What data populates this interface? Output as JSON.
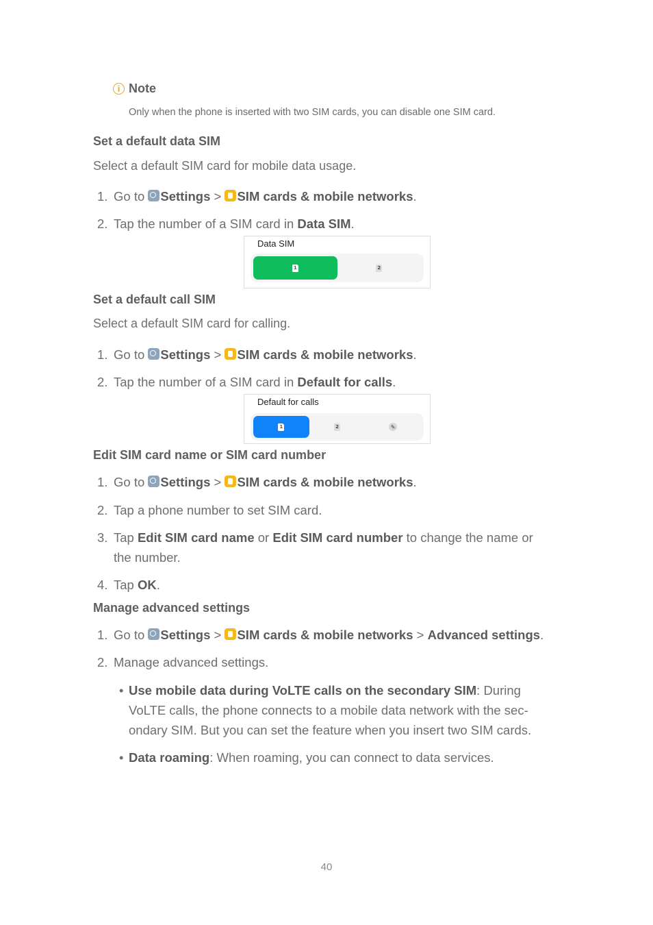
{
  "note": {
    "title": "Note",
    "icon": "info-icon",
    "text": "Only when the phone is inserted with two SIM cards, you can disable one SIM card."
  },
  "nav": {
    "go_to": "Go to ",
    "settings": "Settings",
    "sep": " > ",
    "sim_networks": "SIM cards & mobile networks",
    "advanced": "Advanced settings",
    "period": "."
  },
  "sections": {
    "data_sim": {
      "heading": "Set a default data SIM",
      "intro": "Select a default SIM card for mobile data usage.",
      "step1_num": "1.",
      "step2_num": "2.",
      "step2_pre": "Tap the number of a SIM card in ",
      "step2_bold": "Data SIM",
      "step2_post": ".",
      "card": {
        "label": "Data SIM",
        "options": [
          "1",
          "2"
        ],
        "selected": "1",
        "accent": "#10bd5c"
      }
    },
    "call_sim": {
      "heading": "Set a default call SIM",
      "intro": "Select a default SIM card for calling.",
      "step1_num": "1.",
      "step2_num": "2.",
      "step2_pre": "Tap the number of a SIM card in ",
      "step2_bold": "Default for calls",
      "step2_post": ".",
      "card": {
        "label": "Default for calls",
        "options": [
          "1",
          "2",
          "edit"
        ],
        "selected": "1",
        "accent": "#1083fb"
      }
    },
    "edit_sim": {
      "heading": "Edit SIM card name or SIM card number",
      "step1_num": "1.",
      "step2_num": "2.",
      "step2_text": "Tap a phone number to set SIM card.",
      "step3_num": "3.",
      "step3_pre": "Tap ",
      "step3_bold1": "Edit SIM card name",
      "step3_mid": " or ",
      "step3_bold2": "Edit SIM card number",
      "step3_post": " to change the name or",
      "step3_cont": "the number.",
      "step4_num": "4.",
      "step4_pre": "Tap ",
      "step4_bold": "OK",
      "step4_post": "."
    },
    "advanced": {
      "heading": "Manage advanced settings",
      "step1_num": "1.",
      "step2_num": "2.",
      "step2_text": "Manage advanced settings.",
      "bullets": [
        {
          "bold": "Use mobile data during VoLTE calls on the secondary SIM",
          "text": ": During",
          "cont1": "VoLTE calls, the phone connects to a mobile data network with the sec-",
          "cont2": "ondary SIM. But you can set the feature when you insert two SIM cards."
        },
        {
          "bold": "Data roaming",
          "text": ": When roaming, you can connect to data services."
        }
      ]
    }
  },
  "page_number": "40"
}
